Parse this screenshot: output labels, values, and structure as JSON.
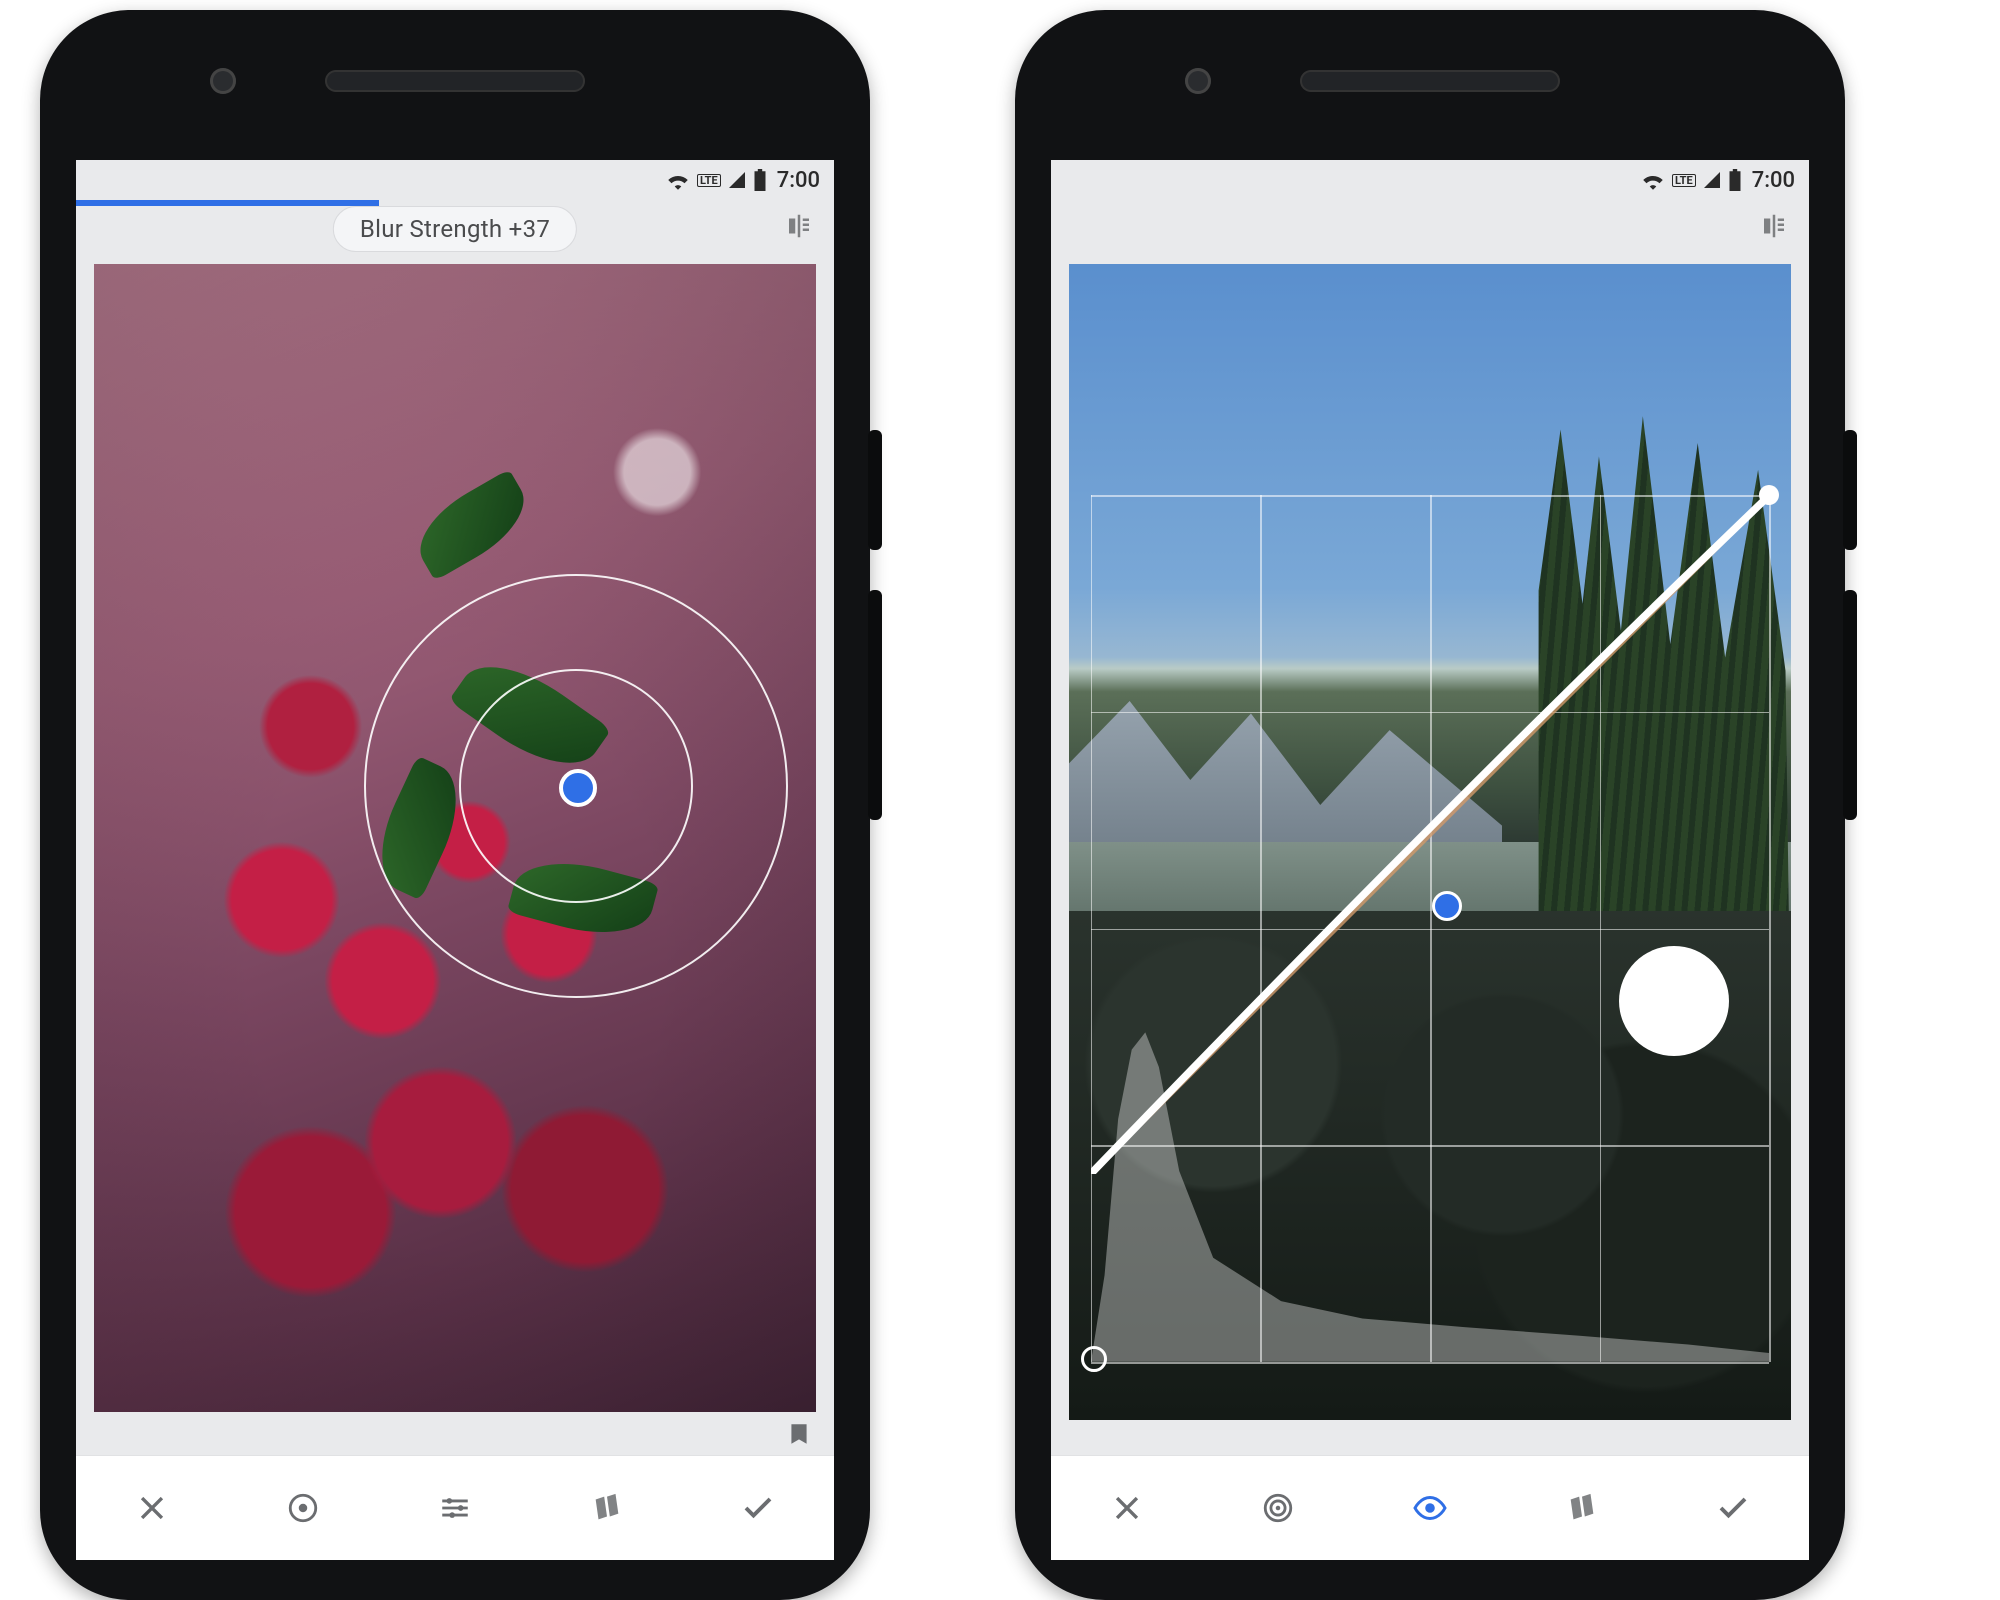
{
  "status": {
    "time": "7:00",
    "lte": "LTE"
  },
  "left": {
    "slider_label": "Blur Strength +37",
    "progress_percent": 40,
    "toolbar": {
      "cancel": "Cancel",
      "focus_shape": "Focus shape",
      "adjust": "Adjust",
      "styles": "Styles",
      "apply": "Apply"
    },
    "compare": "Compare",
    "bookmark": "Bookmark"
  },
  "right": {
    "toolbar": {
      "cancel": "Cancel",
      "channel": "Channel",
      "view": "View",
      "styles": "Styles",
      "apply": "Apply"
    },
    "compare": "Compare"
  },
  "colors": {
    "accent": "#2f6fe6"
  }
}
